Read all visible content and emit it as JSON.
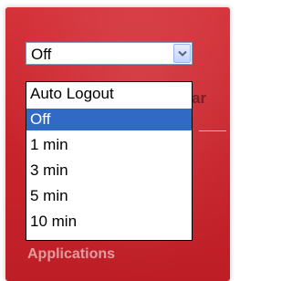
{
  "autologout_select": {
    "selected_value": "Off",
    "options": [
      "Auto Logout",
      "Off",
      "1 min",
      "3 min",
      "5 min",
      "10 min"
    ],
    "highlighted_option": "Off"
  },
  "background": {
    "partial_label": "ar",
    "section_label": "Applications"
  },
  "colors": {
    "panel_red": "#c8232b",
    "highlight_blue": "#316ac5"
  },
  "icons": {
    "dropdown_arrow": "chevron-down-icon"
  }
}
